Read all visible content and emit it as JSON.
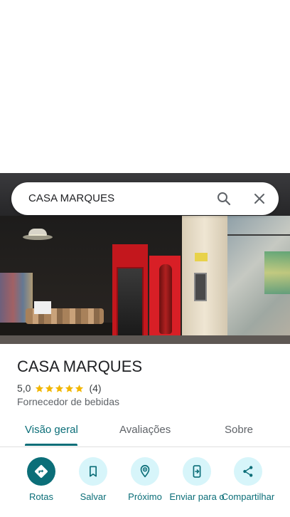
{
  "search": {
    "query": "CASA MARQUES",
    "icons": [
      "search-icon",
      "close-icon"
    ]
  },
  "place": {
    "name": "CASA MARQUES",
    "rating": "5,0",
    "stars": 5,
    "review_count": "(4)",
    "category": "Fornecedor de bebidas"
  },
  "tabs": [
    {
      "label": "Visão geral",
      "selected": true
    },
    {
      "label": "Avaliações",
      "selected": false
    },
    {
      "label": "Sobre",
      "selected": false
    }
  ],
  "actions": [
    {
      "label": "Rotas",
      "icon": "directions-icon"
    },
    {
      "label": "Salvar",
      "icon": "bookmark-icon"
    },
    {
      "label": "Próximo",
      "icon": "nearby-icon"
    },
    {
      "label": "Enviar para o",
      "icon": "send-to-phone-icon"
    },
    {
      "label": "Compartilhar",
      "icon": "share-icon"
    }
  ],
  "colors": {
    "accent": "#0b6e78",
    "action_bg": "#d7f5fa",
    "star": "#f2b600"
  }
}
